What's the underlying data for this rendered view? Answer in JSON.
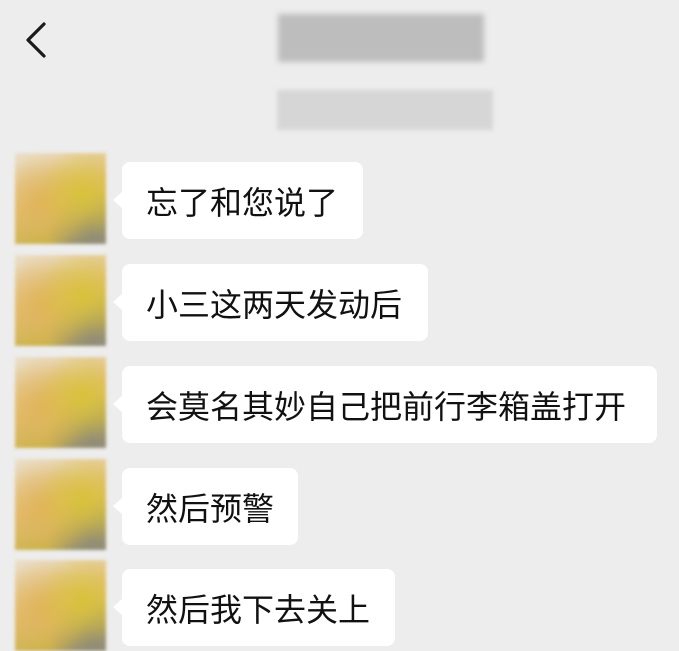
{
  "header": {
    "back_icon": "chevron-left-icon",
    "title": ""
  },
  "messages": [
    {
      "text": "忘了和您说了"
    },
    {
      "text": "小三这两天发动后"
    },
    {
      "text": "会莫名其妙自己把前行李箱盖打开"
    },
    {
      "text": "然后预警"
    },
    {
      "text": "然后我下去关上"
    }
  ],
  "colors": {
    "background": "#ededed",
    "bubble": "#ffffff",
    "text": "#111111"
  }
}
